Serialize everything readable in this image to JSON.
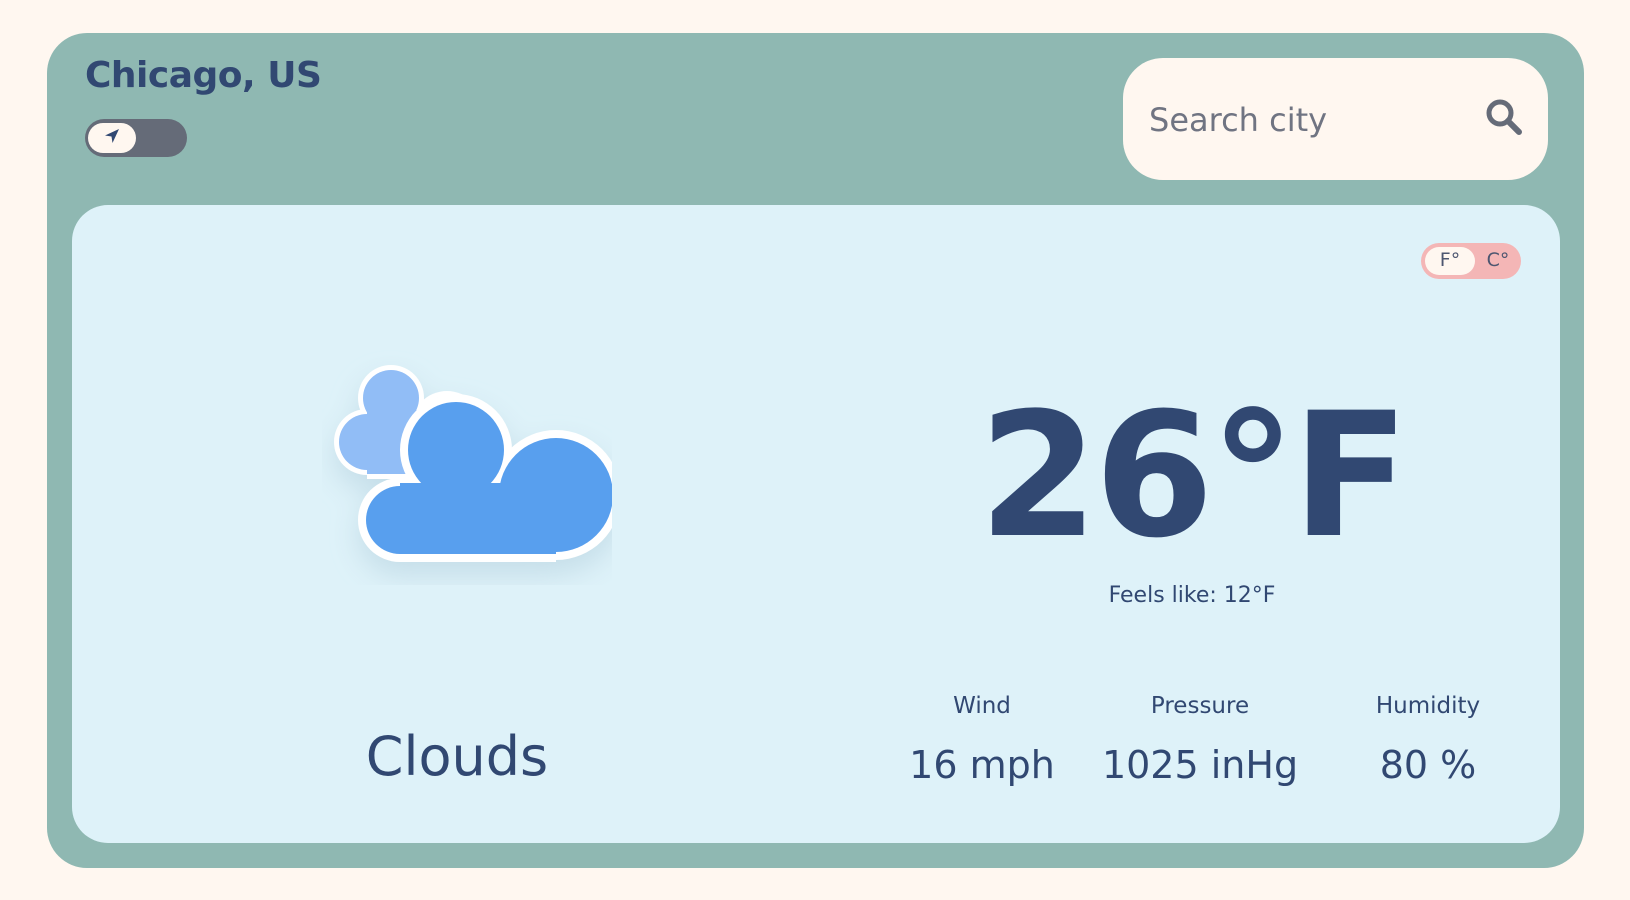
{
  "location": {
    "city": "Chicago, US",
    "geolocation_toggle_icon": "location-arrow-icon"
  },
  "search": {
    "placeholder": "Search city",
    "icon": "search-icon"
  },
  "units": {
    "fahrenheit": "F°",
    "celsius": "C°",
    "selected": "F°"
  },
  "weather": {
    "icon": "clouds-icon",
    "description": "Clouds",
    "temperature": "26°F",
    "feels_like": "Feels like: 12°F"
  },
  "stats": {
    "wind": {
      "label": "Wind",
      "value": "16 mph"
    },
    "pressure": {
      "label": "Pressure",
      "value": "1025 inHg"
    },
    "humidity": {
      "label": "Humidity",
      "value": "80 %"
    }
  },
  "colors": {
    "page_background": "#fff7f0",
    "app_background": "#8fb8b2",
    "card_background": "#def2f9",
    "text_primary": "#314872",
    "toggle_dark": "#656b78",
    "unit_toggle": "#f4b6b6",
    "cloud_front": "#599fee",
    "cloud_back": "#91bdf6"
  }
}
